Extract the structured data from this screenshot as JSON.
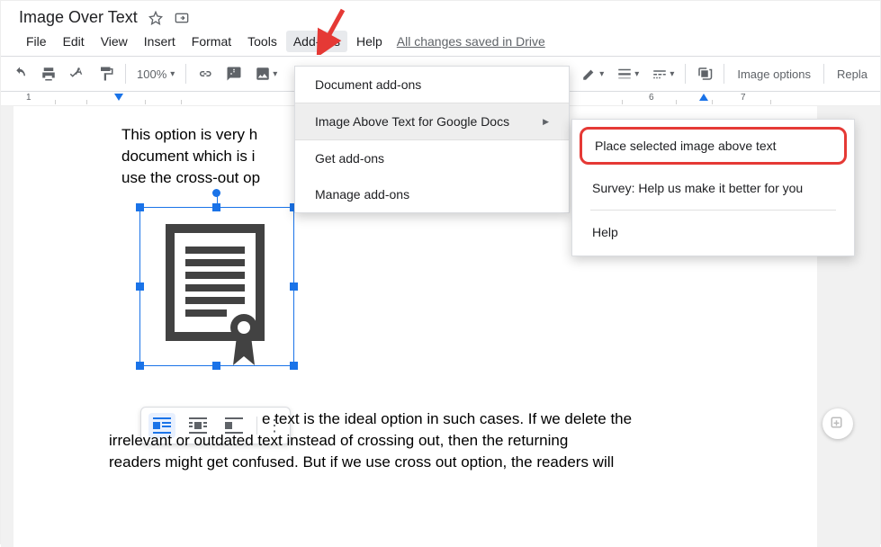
{
  "header": {
    "doc_title": "Image Over Text",
    "save_status": "All changes saved in Drive"
  },
  "menubar": {
    "file": "File",
    "edit": "Edit",
    "view": "View",
    "insert": "Insert",
    "format": "Format",
    "tools": "Tools",
    "addons": "Add-ons",
    "help": "Help"
  },
  "toolbar": {
    "zoom": "100%",
    "image_options": "Image options",
    "replace": "Repla"
  },
  "ruler": {
    "n1": "1",
    "n6": "6",
    "n7": "7"
  },
  "document": {
    "p1_l1": "This option is very h",
    "p1_l2": "document which is i",
    "p1_l3": "use the cross-out op",
    "p2_l1_suffix": "e text is the ideal option in such cases. If we delete the",
    "p2_l2": "irrelevant or outdated text instead of crossing out, then the returning",
    "p2_l3": "readers might get confused. But if we use cross out option, the readers will"
  },
  "dropdown": {
    "doc_addons": "Document add-ons",
    "image_above": "Image Above Text for Google Docs",
    "get_addons": "Get add-ons",
    "manage_addons": "Manage add-ons"
  },
  "submenu": {
    "place": "Place selected image above text",
    "survey": "Survey: Help us make it better for you",
    "help": "Help"
  },
  "icons": {
    "arrow_right": "▶",
    "dropdown_tri": "▾",
    "zoom_tri": "▾"
  }
}
